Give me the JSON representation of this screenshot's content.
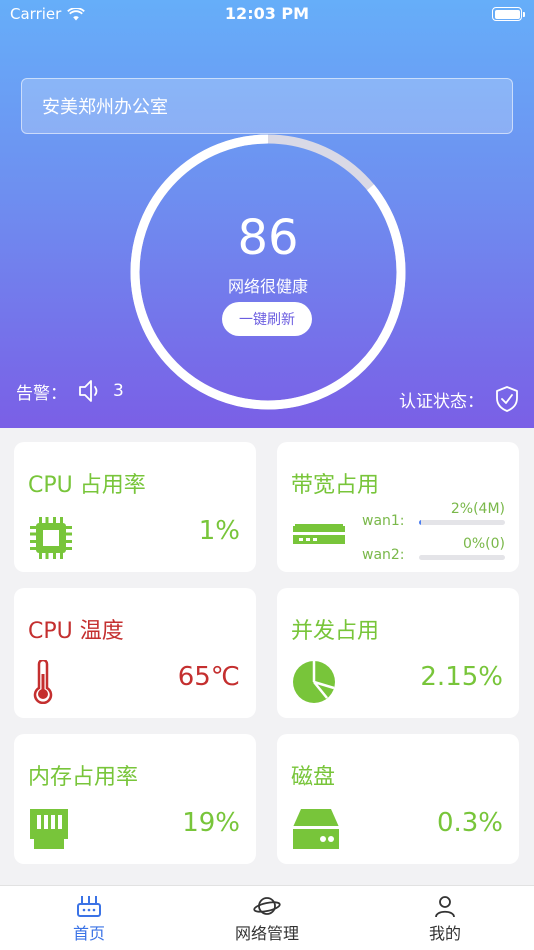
{
  "status_bar": {
    "carrier": "Carrier",
    "time": "12:03 PM"
  },
  "site": {
    "name": "安美郑州办公室"
  },
  "health": {
    "score": "86",
    "score_value": 86,
    "status": "网络很健康",
    "refresh_label": "一键刷新"
  },
  "alarm": {
    "label": "告警：",
    "count": "3"
  },
  "auth": {
    "label": "认证状态："
  },
  "cards": {
    "cpu_usage": {
      "title": "CPU 占用率",
      "value": "1%"
    },
    "bandwidth": {
      "title": "带宽占用",
      "wan1": {
        "label": "wan1:",
        "value": "2%(4M)",
        "fraction": 0.02
      },
      "wan2": {
        "label": "wan2:",
        "value": "0%(0)",
        "fraction": 0
      }
    },
    "cpu_temp": {
      "title": "CPU 温度",
      "value": "65℃"
    },
    "concurrency": {
      "title": "并发占用",
      "value": "2.15%"
    },
    "memory": {
      "title": "内存占用率",
      "value": "19%"
    },
    "disk": {
      "title": "磁盘",
      "value": "0.3%"
    }
  },
  "tabs": [
    {
      "label": "首页",
      "active": true
    },
    {
      "label": "网络管理",
      "active": false
    },
    {
      "label": "我的",
      "active": false
    }
  ],
  "colors": {
    "green": "#78c53a",
    "red": "#c42f2f",
    "tab_active": "#3b73e6",
    "gauge_bg": "#d9d9e6"
  }
}
